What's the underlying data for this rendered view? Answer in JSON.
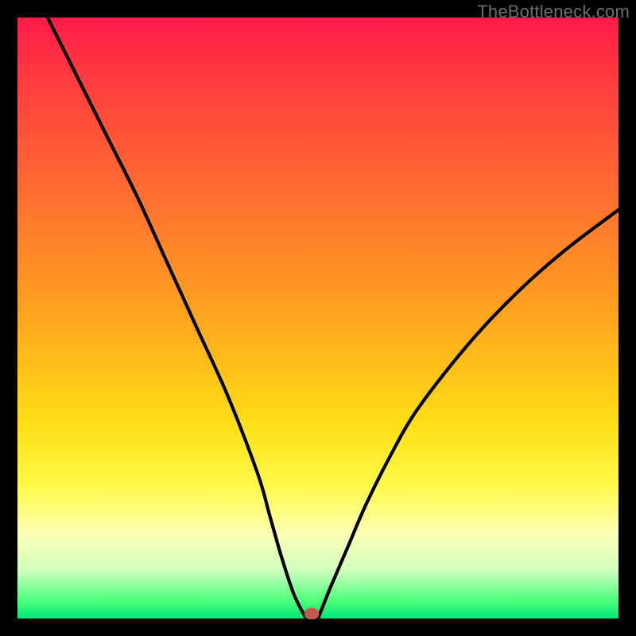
{
  "watermark": "TheBottleneck.com",
  "chart_data": {
    "type": "line",
    "title": "",
    "xlabel": "",
    "ylabel": "",
    "xlim": [
      0,
      100
    ],
    "ylim": [
      0,
      100
    ],
    "grid": false,
    "legend": false,
    "series": [
      {
        "name": "left-branch",
        "x": [
          5,
          10,
          15,
          20,
          25,
          30,
          35,
          40,
          42,
          44,
          46,
          48
        ],
        "y": [
          100,
          90,
          80,
          70,
          59,
          48,
          37,
          24,
          17,
          10,
          4,
          0
        ]
      },
      {
        "name": "right-branch",
        "x": [
          50,
          52,
          55,
          58,
          62,
          66,
          72,
          78,
          85,
          92,
          100
        ],
        "y": [
          0,
          5,
          12,
          19,
          27,
          34,
          42,
          49,
          56,
          62,
          68
        ]
      }
    ],
    "marker": {
      "x": 49,
      "y": 0.8,
      "color": "#c05a50"
    },
    "background_gradient": {
      "top": "#ff1a4b",
      "mid": "#ffe017",
      "bottom": "#00e676"
    }
  }
}
